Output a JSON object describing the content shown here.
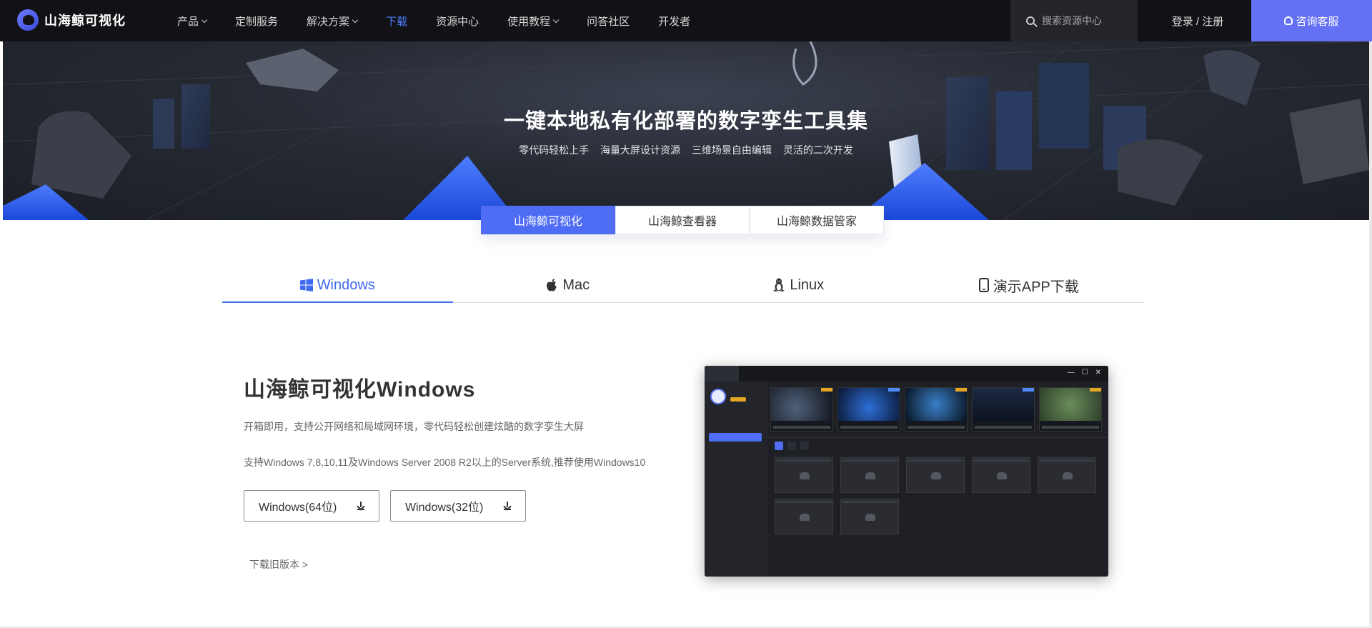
{
  "brand": {
    "name": "山海鲸可视化"
  },
  "nav": {
    "items": [
      {
        "label": "产品",
        "dropdown": true,
        "active": false
      },
      {
        "label": "定制服务",
        "dropdown": false,
        "active": false
      },
      {
        "label": "解决方案",
        "dropdown": true,
        "active": false
      },
      {
        "label": "下载",
        "dropdown": false,
        "active": true
      },
      {
        "label": "资源中心",
        "dropdown": false,
        "active": false
      },
      {
        "label": "使用教程",
        "dropdown": true,
        "active": false
      },
      {
        "label": "问答社区",
        "dropdown": false,
        "active": false
      },
      {
        "label": "开发者",
        "dropdown": false,
        "active": false
      }
    ],
    "search_placeholder": "搜索资源中心",
    "login_label": "登录 / 注册",
    "consult_label": "咨询客服"
  },
  "hero": {
    "title": "一键本地私有化部署的数字孪生工具集",
    "features": [
      "零代码轻松上手",
      "海量大屏设计资源",
      "三维场景自由编辑",
      "灵活的二次开发"
    ]
  },
  "product_tabs": [
    {
      "label": "山海鲸可视化",
      "active": true
    },
    {
      "label": "山海鲸查看器",
      "active": false
    },
    {
      "label": "山海鲸数据管家",
      "active": false
    }
  ],
  "os_tabs": [
    {
      "label": "Windows",
      "icon": "windows-icon",
      "active": true
    },
    {
      "label": "Mac",
      "icon": "apple-icon",
      "active": false
    },
    {
      "label": "Linux",
      "icon": "linux-icon",
      "active": false
    },
    {
      "label": "演示APP下载",
      "icon": "phone-icon",
      "active": false
    }
  ],
  "content": {
    "title": "山海鲸可视化Windows",
    "desc1": "开箱即用，支持公开网络和局域网环境，零代码轻松创建炫酷的数字孪生大屏",
    "desc2": "支持Windows 7,8,10,11及Windows Server 2008 R2以上的Server系统,推荐使用Windows10",
    "buttons": [
      "Windows(64位)",
      "Windows(32位)"
    ],
    "old_versions": "下载旧版本 >"
  },
  "colors": {
    "accent": "#4e6cf4",
    "nav_bg": "#121216",
    "consult_bg": "#6471f5",
    "active_link": "#3f6af0"
  }
}
